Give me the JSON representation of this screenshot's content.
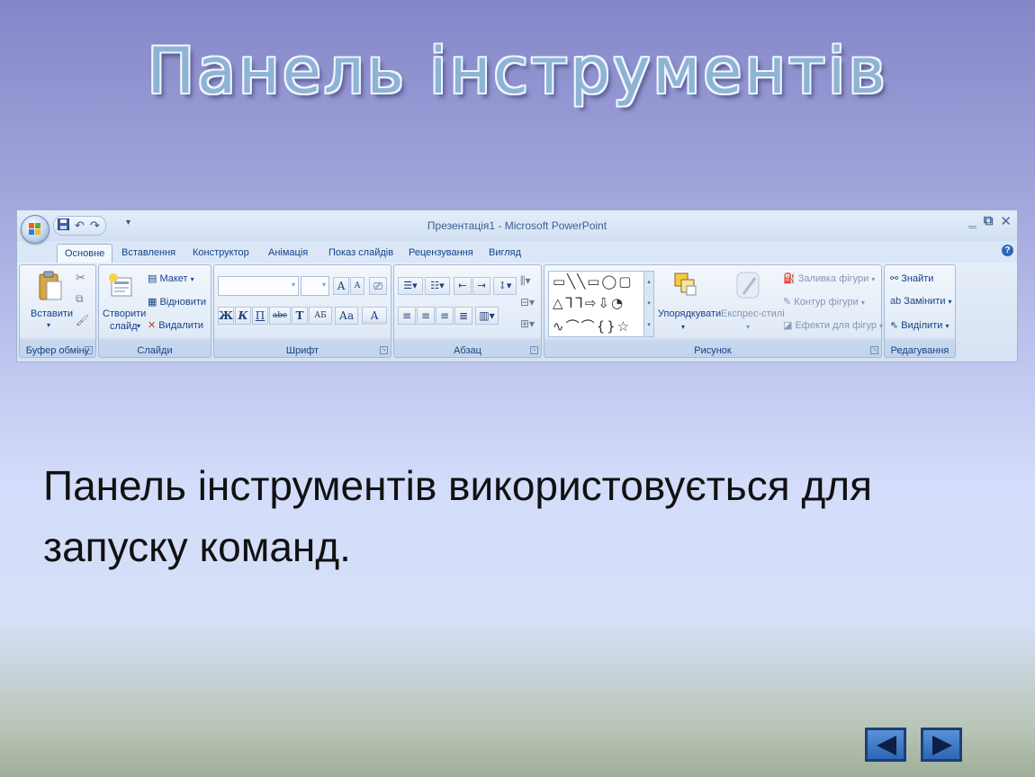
{
  "slide": {
    "title": "Панель інструментів",
    "body": "Панель інструментів використовується для запуску команд."
  },
  "ribbon": {
    "window_title": "Презентація1 - Microsoft PowerPoint",
    "quick_access": {
      "save": "save-icon",
      "undo": "↶",
      "redo": "↷"
    },
    "tabs": [
      {
        "label": "Основне",
        "active": true
      },
      {
        "label": "Вставлення"
      },
      {
        "label": "Конструктор"
      },
      {
        "label": "Анімація"
      },
      {
        "label": "Показ слайдів"
      },
      {
        "label": "Рецензування"
      },
      {
        "label": "Вигляд"
      }
    ],
    "clipboard": {
      "label": "Буфер обміну",
      "paste": "Вставити"
    },
    "slides": {
      "label": "Слайди",
      "new_slide_line1": "Створити",
      "new_slide_line2": "слайд",
      "layout": "Макет",
      "reset": "Відновити",
      "delete": "Видалити"
    },
    "font": {
      "label": "Шрифт",
      "bold": "Ж",
      "italic": "К",
      "underline": "П",
      "strike": "abc",
      "shadow": "Т",
      "spacing": "АБ",
      "case": "Аа",
      "color": "А",
      "grow": "А",
      "shrink": "А"
    },
    "paragraph": {
      "label": "Абзац"
    },
    "drawing": {
      "label": "Рисунок",
      "arrange": "Упорядкувати",
      "quick_styles": "Експрес-стилі",
      "fill": "Заливка фігури",
      "outline": "Контур фігури",
      "effects": "Ефекти для фігур"
    },
    "editing": {
      "label": "Редагування",
      "find": "Знайти",
      "replace": "Замінити",
      "select": "Виділити"
    }
  },
  "navigation": {
    "prev": "previous-arrow",
    "next": "next-arrow"
  },
  "colors": {
    "accent": "#2e66b5",
    "title": "#8fb3d4"
  }
}
